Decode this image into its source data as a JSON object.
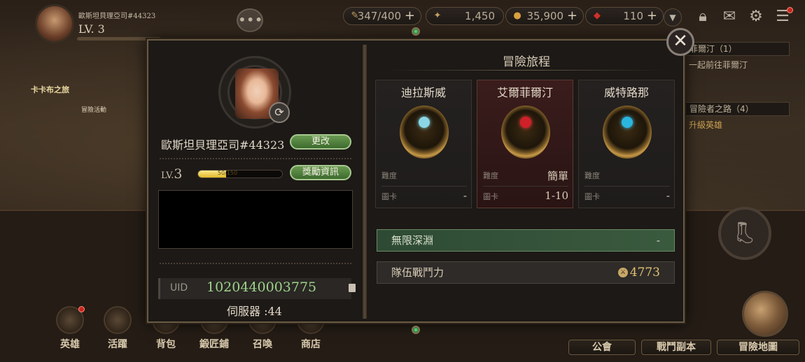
{
  "topbar": {
    "player_name": "歐斯坦貝理亞司#44323",
    "level": "LV. 3",
    "resources": [
      {
        "name": "stamina",
        "icon": "feather-icon",
        "value": "347/400"
      },
      {
        "name": "star-currency",
        "icon": "star-badge-icon",
        "value": "1,450"
      },
      {
        "name": "gold",
        "icon": "coin-icon",
        "value": "35,900"
      },
      {
        "name": "gem",
        "icon": "red-crystal-icon",
        "value": "110"
      }
    ]
  },
  "background": {
    "quest1": "菲爾汀（1）",
    "quest1_sub": "一起前往菲爾汀",
    "quest2": "冒險者之路（4）",
    "quest2_sub": "升級英雄",
    "sign": "卡卡布之旅",
    "event_label": "冒險活動"
  },
  "bottom_nav": [
    "英雄",
    "活躍",
    "背包",
    "鍛匠鋪",
    "召喚",
    "商店"
  ],
  "right_nav": [
    "公會",
    "戰鬥副本",
    "冒險地圖"
  ],
  "profile": {
    "name": "歐斯坦貝理亞司#44323",
    "change_button": "更改",
    "level_prefix": "LV.",
    "level_value": "3",
    "xp_text": "50/150",
    "xp_fraction": 0.33,
    "reward_button": "獎勵資訊",
    "uid_label": "UID",
    "uid_value": "1020440003775",
    "server": "伺服器 :44"
  },
  "journey": {
    "title": "冒險旅程",
    "difficulty_label": "難度",
    "stage_label": "圖卡",
    "regions": [
      {
        "name": "迪拉斯威",
        "difficulty": "",
        "stage": "-",
        "core_color": "#8ad6e6"
      },
      {
        "name": "艾爾菲爾汀",
        "difficulty": "簡單",
        "stage": "1-10",
        "core_color": "#d0202a"
      },
      {
        "name": "威特路那",
        "difficulty": "",
        "stage": "-",
        "core_color": "#2ab6e0"
      }
    ],
    "abyss_label": "無限深淵",
    "abyss_value": "-",
    "power_label": "隊伍戰鬥力",
    "power_value": "4773"
  }
}
